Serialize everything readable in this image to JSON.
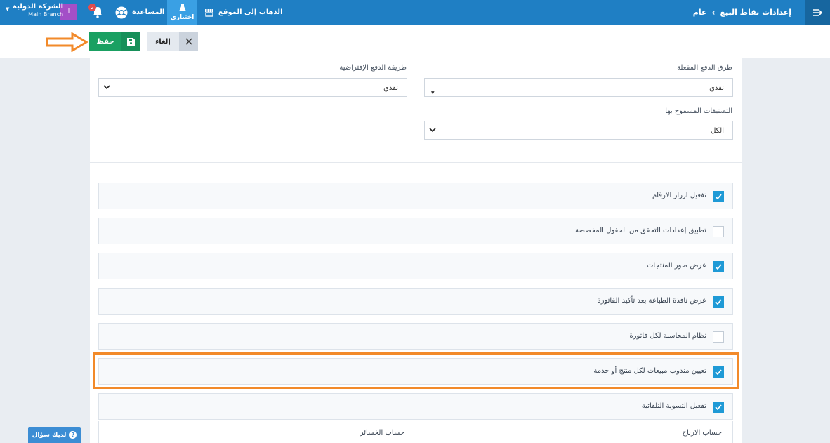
{
  "topbar": {
    "breadcrumb_main": "إعدادات نقاط البيع",
    "breadcrumb_sub": "عام",
    "company_name": "الشركة الدولية",
    "branch_name": "Main Branch",
    "avatar_letter": "ا",
    "notifications_count": "2",
    "help_label": "المساعدة",
    "trial_label": "اختياري",
    "goto_site_label": "الذهاب إلى الموقع",
    "bar_color": "#1f7fc4"
  },
  "actions": {
    "save_label": "حفظ",
    "cancel_label": "إلغاء"
  },
  "form": {
    "enabled_payment_methods_label": "طرق الدفع المفعلة",
    "enabled_payment_methods_value": "نقدي",
    "default_payment_method_label": "طريقة الدفع الإفتراضية",
    "default_payment_method_value": "نقدي",
    "allowed_categories_label": "التصنيفات المسموح بها",
    "allowed_categories_value": "الكل"
  },
  "options": [
    {
      "label": "تفعيل ازرار الارقام",
      "checked": true
    },
    {
      "label": "تطبيق إعدادات التحقق من الحقول المخصصة",
      "checked": false
    },
    {
      "label": "عرض صور المنتجات",
      "checked": true
    },
    {
      "label": "عرض نافذة الطباعة بعد تأكيد الفاتورة",
      "checked": true
    },
    {
      "label": "نظام المحاسبة لكل فاتورة",
      "checked": false
    },
    {
      "label": "تعيين مندوب مبيعات لكل منتج أو خدمة",
      "checked": true
    },
    {
      "label": "تفعيل التسوية التلقائية",
      "checked": true
    }
  ],
  "auto_settlement": {
    "profit_account_label": "حساب الارباح",
    "loss_account_label": "حساب الخسائر"
  },
  "help_button_label": "لديك سؤال",
  "colors": {
    "highlight": "#f28a2a",
    "accent": "#1f9ad6",
    "save": "#1aa062"
  }
}
